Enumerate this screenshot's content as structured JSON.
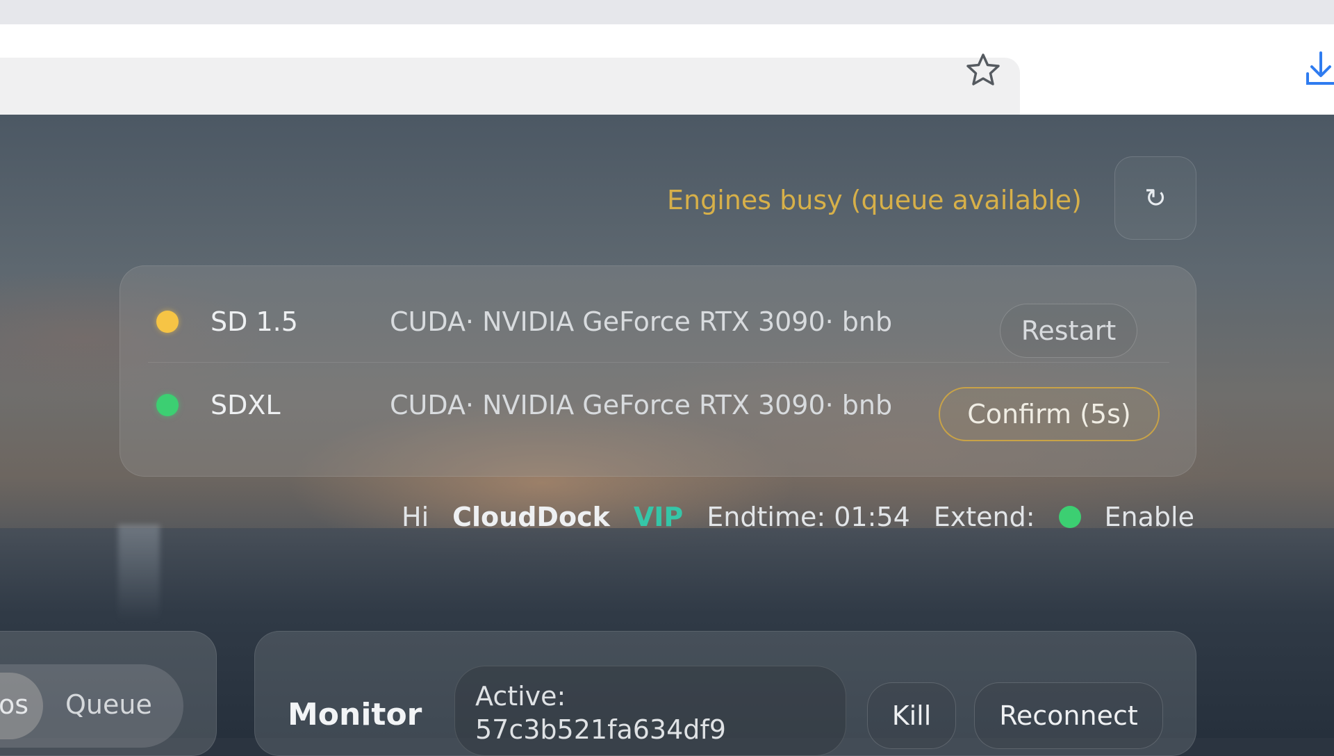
{
  "browser": {
    "bookmark_icon": "star-outline-icon",
    "download_icon": "download-arrow-icon"
  },
  "header": {
    "status_text": "Engines busy (queue available)",
    "status_color": "#d7b049",
    "refresh_glyph": "↻"
  },
  "engines": [
    {
      "name": "SD 1.5",
      "status_color": "yellow",
      "description": "CUDA· NVIDIA GeForce RTX 3090· bnb",
      "action_label": "Restart"
    },
    {
      "name": "SDXL",
      "status_color": "green",
      "description": "CUDA· NVIDIA GeForce RTX 3090· bnb",
      "action_label": "Confirm (5s)"
    }
  ],
  "user": {
    "greeting": "Hi",
    "username": "CloudDock",
    "tier": "VIP",
    "endtime": "Endtime: 01:54",
    "extend_label": "Extend:",
    "extend_value": "Enable"
  },
  "tabs": {
    "items": [
      "os",
      "Queue"
    ]
  },
  "monitor": {
    "title": "Monitor",
    "active_label": "Active:",
    "active_id": "57c3b521fa634df9",
    "kill_label": "Kill",
    "reconnect_label": "Reconnect"
  },
  "colors": {
    "accent_gold": "#c9a347",
    "vip_teal": "#35c6a8",
    "status_green": "#3ccf72",
    "status_yellow": "#f6c445"
  }
}
